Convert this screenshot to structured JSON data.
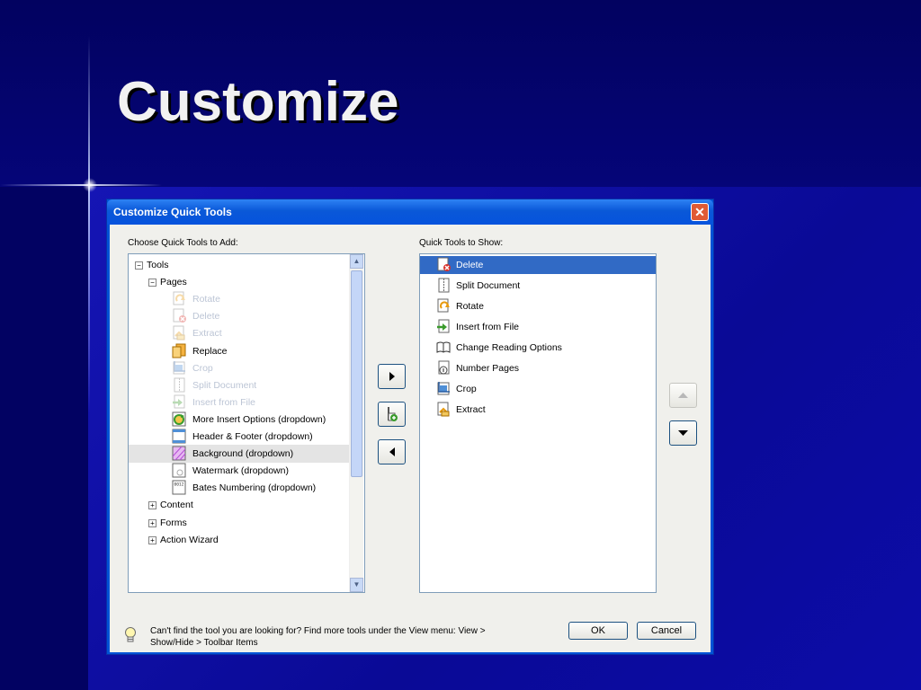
{
  "slide": {
    "title": "Customize"
  },
  "dialog": {
    "title": "Customize Quick Tools",
    "close_symbol": "✕",
    "left_label": "Choose Quick Tools to Add:",
    "right_label": "Quick Tools to Show:",
    "tree": [
      {
        "label": "Tools",
        "level": 0,
        "expander": "−",
        "enabled": true
      },
      {
        "label": "Pages",
        "level": 1,
        "expander": "−",
        "enabled": true
      },
      {
        "label": "Rotate",
        "level": 2,
        "icon": "rotate-icon",
        "enabled": false
      },
      {
        "label": "Delete",
        "level": 2,
        "icon": "delete-page-icon",
        "enabled": false
      },
      {
        "label": "Extract",
        "level": 2,
        "icon": "extract-icon",
        "enabled": false
      },
      {
        "label": "Replace",
        "level": 2,
        "icon": "replace-icon",
        "enabled": true
      },
      {
        "label": "Crop",
        "level": 2,
        "icon": "crop-icon",
        "enabled": false
      },
      {
        "label": "Split Document",
        "level": 2,
        "icon": "split-document-icon",
        "enabled": false
      },
      {
        "label": "Insert from File",
        "level": 2,
        "icon": "insert-from-file-icon",
        "enabled": false
      },
      {
        "label": "More Insert Options  (dropdown)",
        "level": 2,
        "icon": "insert-options-icon",
        "enabled": true
      },
      {
        "label": "Header & Footer  (dropdown)",
        "level": 2,
        "icon": "header-footer-icon",
        "enabled": true
      },
      {
        "label": "Background  (dropdown)",
        "level": 2,
        "icon": "background-icon",
        "enabled": true,
        "highlighted": true
      },
      {
        "label": "Watermark  (dropdown)",
        "level": 2,
        "icon": "watermark-icon",
        "enabled": true
      },
      {
        "label": "Bates Numbering  (dropdown)",
        "level": 2,
        "icon": "bates-numbering-icon",
        "enabled": true
      },
      {
        "label": "Content",
        "level": 1,
        "expander": "+",
        "enabled": true
      },
      {
        "label": "Forms",
        "level": 1,
        "expander": "+",
        "enabled": true
      },
      {
        "label": "Action Wizard",
        "level": 1,
        "expander": "+",
        "enabled": true
      }
    ],
    "shown_tools": [
      {
        "label": "Delete",
        "icon": "delete-page-icon",
        "selected": true
      },
      {
        "label": "Split Document",
        "icon": "split-document-icon"
      },
      {
        "label": "Rotate",
        "icon": "rotate-icon"
      },
      {
        "label": "Insert from File",
        "icon": "insert-from-file-icon"
      },
      {
        "label": "Change Reading Options",
        "icon": "reading-options-icon"
      },
      {
        "label": "Number Pages",
        "icon": "number-pages-icon"
      },
      {
        "label": "Crop",
        "icon": "crop-icon"
      },
      {
        "label": "Extract",
        "icon": "extract-icon"
      }
    ],
    "hint": "Can't find the tool you are looking for? Find more tools under the View menu: View > Show/Hide > Toolbar Items",
    "ok_label": "OK",
    "cancel_label": "Cancel",
    "colors": {
      "selection": "#316ac5",
      "titlebar": "#0553dd",
      "disabled_text": "#bcc5d5"
    }
  }
}
